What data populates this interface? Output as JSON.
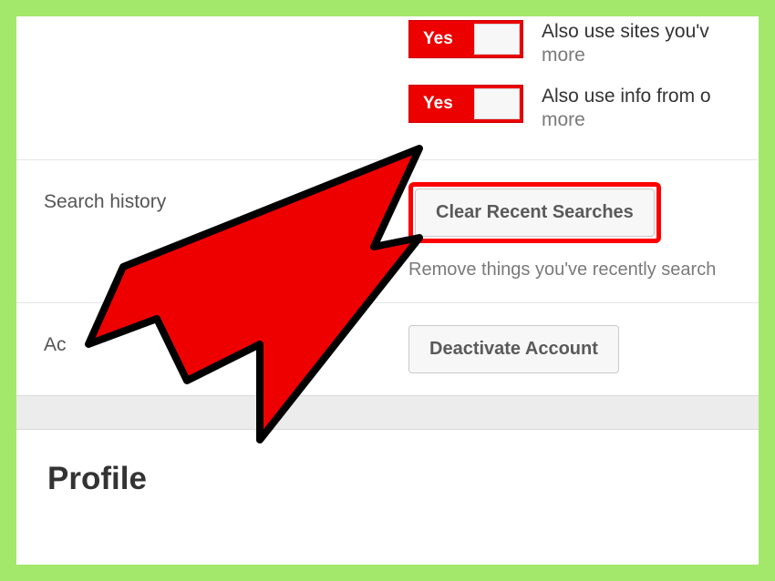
{
  "toggles": [
    {
      "state": "Yes",
      "desc_line1": "Also use sites you'v",
      "more": "more"
    },
    {
      "state": "Yes",
      "desc_line1": "Also use info from o",
      "more": "more"
    }
  ],
  "rows": {
    "search_history": {
      "label": "Search history",
      "button": "Clear Recent Searches",
      "helper": "Remove things you've recently search"
    },
    "account": {
      "label": "Ac",
      "button": "Deactivate Account"
    }
  },
  "profile_heading": "Profile"
}
